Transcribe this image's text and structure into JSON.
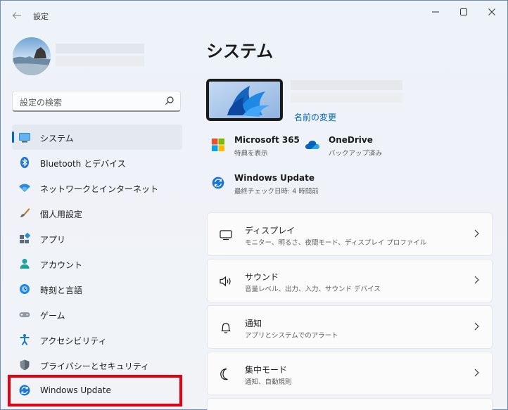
{
  "window": {
    "app_title": "設定",
    "back_icon": "arrow-left-icon",
    "minimize_icon": "minimize-icon",
    "maximize_icon": "maximize-icon",
    "close_icon": "close-icon"
  },
  "sidebar": {
    "search": {
      "placeholder": "設定の検索",
      "icon": "search-icon"
    },
    "items": [
      {
        "label": "システム",
        "icon": "system-display-icon",
        "selected": true
      },
      {
        "label": "Bluetooth とデバイス",
        "icon": "bluetooth-icon"
      },
      {
        "label": "ネットワークとインターネット",
        "icon": "wifi-icon"
      },
      {
        "label": "個人用設定",
        "icon": "paintbrush-icon"
      },
      {
        "label": "アプリ",
        "icon": "apps-icon"
      },
      {
        "label": "アカウント",
        "icon": "account-icon"
      },
      {
        "label": "時刻と言語",
        "icon": "time-language-icon"
      },
      {
        "label": "ゲーム",
        "icon": "gamepad-icon"
      },
      {
        "label": "アクセシビリティ",
        "icon": "accessibility-icon"
      },
      {
        "label": "プライバシーとセキュリティ",
        "icon": "shield-icon"
      },
      {
        "label": "Windows Update",
        "icon": "windows-update-icon",
        "highlighted": true
      }
    ],
    "highlight_color": "#e60012",
    "accent_color": "#0067c0"
  },
  "main": {
    "title": "システム",
    "rename_link": "名前の変更",
    "quick_links": [
      {
        "title": "Microsoft 365",
        "subtitle": "特典を表示",
        "icon": "microsoft-365-icon"
      },
      {
        "title": "OneDrive",
        "subtitle": "バックアップ済み",
        "icon": "onedrive-cloud-icon"
      },
      {
        "title": "Windows Update",
        "subtitle": "最終チェック日時: 4 時間前",
        "icon": "windows-update-icon"
      }
    ],
    "cards": [
      {
        "title": "ディスプレイ",
        "subtitle": "モニター、明るさ、夜間モード、ディスプレイ プロファイル",
        "icon": "monitor-icon"
      },
      {
        "title": "サウンド",
        "subtitle": "音量レベル、出力、入力、サウンド デバイス",
        "icon": "speaker-icon"
      },
      {
        "title": "通知",
        "subtitle": "アプリとシステムでのアラート",
        "icon": "bell-icon"
      },
      {
        "title": "集中モード",
        "subtitle": "通知、自動規則",
        "icon": "moon-icon"
      }
    ]
  }
}
